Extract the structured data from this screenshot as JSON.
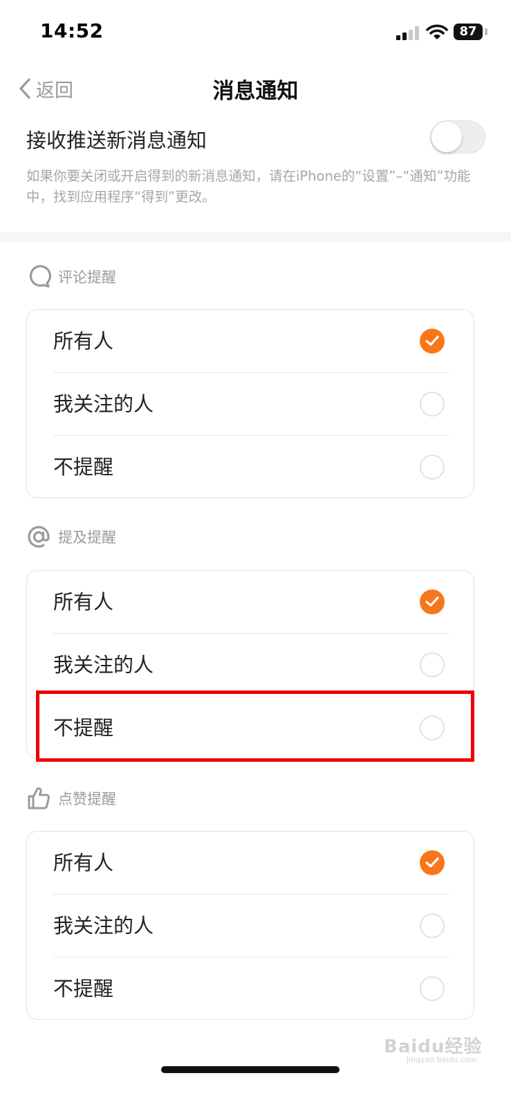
{
  "status_bar": {
    "time": "14:52",
    "battery": "87"
  },
  "nav": {
    "back_label": "返回",
    "title": "消息通知"
  },
  "push": {
    "label": "接收推送新消息通知",
    "enabled": false,
    "hint": "如果你要关闭或开启得到的新消息通知，请在iPhone的“设置”–“通知”功能中，找到应用程序“得到”更改。"
  },
  "sections": [
    {
      "title": "评论提醒",
      "icon": "comment-bubble-icon",
      "options": [
        {
          "label": "所有人",
          "checked": true
        },
        {
          "label": "我关注的人",
          "checked": false
        },
        {
          "label": "不提醒",
          "checked": false
        }
      ]
    },
    {
      "title": "提及提醒",
      "icon": "at-sign-icon",
      "options": [
        {
          "label": "所有人",
          "checked": true
        },
        {
          "label": "我关注的人",
          "checked": false
        },
        {
          "label": "不提醒",
          "checked": false
        }
      ]
    },
    {
      "title": "点赞提醒",
      "icon": "thumbs-up-icon",
      "options": [
        {
          "label": "所有人",
          "checked": true
        },
        {
          "label": "我关注的人",
          "checked": false
        },
        {
          "label": "不提醒",
          "checked": false
        }
      ]
    }
  ],
  "colors": {
    "accent": "#f8761a",
    "highlight": "#ee0000"
  },
  "watermark": {
    "brand": "Baidu经验",
    "url": "jingyan.baidu.com"
  }
}
